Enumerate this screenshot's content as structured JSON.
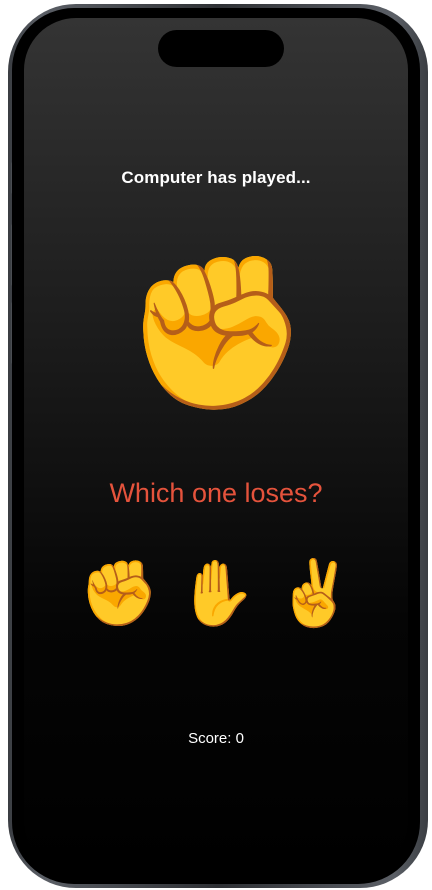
{
  "game": {
    "computer_label": "Computer has played...",
    "computer_move": "✊",
    "prompt": "Which one loses?",
    "prompt_color": "#e5533c",
    "choices": [
      {
        "name": "rock",
        "emoji": "✊"
      },
      {
        "name": "paper",
        "emoji": "✋"
      },
      {
        "name": "scissors",
        "emoji": "✌️"
      }
    ],
    "score_text": "Score: 0"
  }
}
